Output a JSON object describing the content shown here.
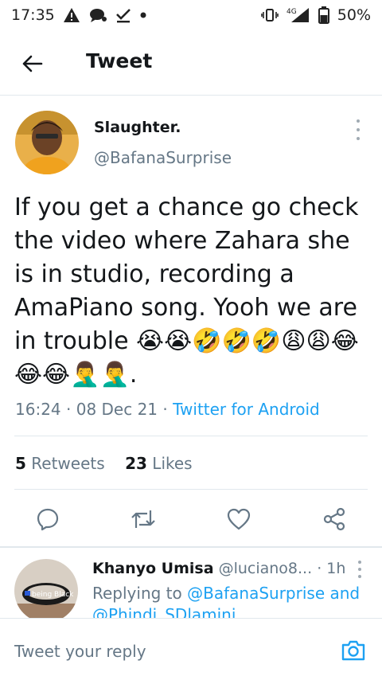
{
  "status_bar": {
    "time": "17:35",
    "network": "4G",
    "battery": "50%",
    "icons": [
      "alert-icon",
      "notification-icon",
      "check-icon",
      "dot-icon",
      "vibrate-icon",
      "signal-icon",
      "battery-icon"
    ]
  },
  "header": {
    "title": "Tweet",
    "back_icon": "arrow-left-icon"
  },
  "tweet": {
    "author_name": "Slaughter.",
    "handle": "@BafanaSurprise",
    "text": "If you get a chance go check the video where Zahara she is in studio, recording a AmaPiano song. Yooh we are in trouble 😭😭🤣🤣🤣😩😩😂😂😂🤦‍♂️🤦‍♂️.",
    "time": "16:24",
    "date": "08 Dec 21",
    "client": "Twitter for Android",
    "retweets": "5",
    "retweets_label": "Retweets",
    "likes": "23",
    "likes_label": "Likes"
  },
  "actions": {
    "icons": [
      "reply-icon",
      "retweet-icon",
      "like-icon",
      "share-icon"
    ]
  },
  "reply": {
    "name": "Khanyo Umisa",
    "handle": "@luciano8...",
    "time": "1h",
    "replying_to_label": "Replying to",
    "mention1": "@BafanaSurprise",
    "and_label": "and",
    "mention2": "@Phindi_SDlamini",
    "avatar_text": "being Black"
  },
  "composer": {
    "placeholder": "Tweet your reply",
    "camera_icon": "camera-icon"
  },
  "colors": {
    "accent": "#1da1f2",
    "text": "#14171a",
    "muted": "#657786",
    "divider": "#e1e8ed"
  }
}
